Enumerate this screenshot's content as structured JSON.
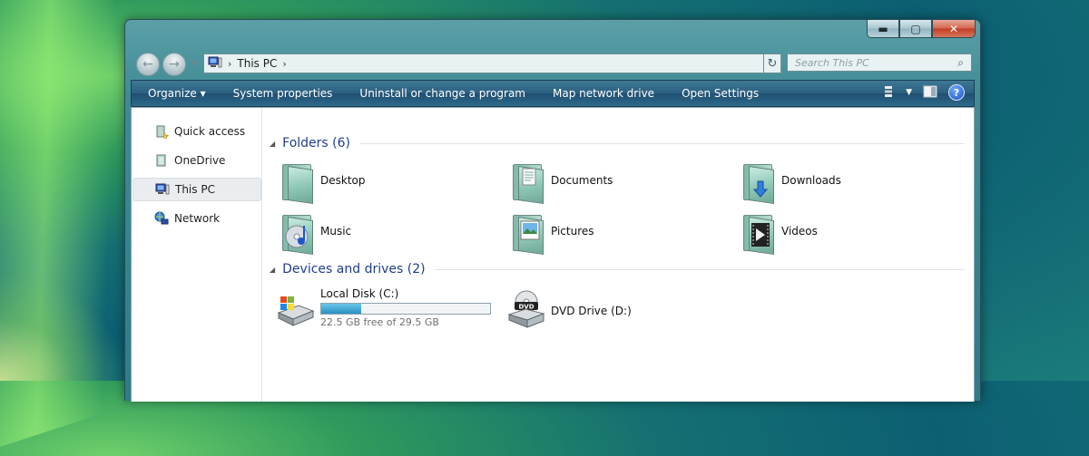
{
  "window": {
    "caption_buttons": {
      "minimize": "▬",
      "maximize": "▢",
      "close": "✕"
    }
  },
  "address_bar": {
    "separator": "›",
    "crumb": "This PC",
    "trailing_separator": "›",
    "dropdown": "⌄",
    "refresh": "↻"
  },
  "search": {
    "placeholder": "Search This PC",
    "icon": "search-icon"
  },
  "toolbar": {
    "organize": "Organize ▾",
    "items": [
      "System properties",
      "Uninstall or change a program",
      "Map network drive",
      "Open Settings"
    ]
  },
  "sidebar": {
    "items": [
      {
        "label": "Quick access",
        "icon": "quick-access-icon"
      },
      {
        "label": "OneDrive",
        "icon": "onedrive-icon"
      },
      {
        "label": "This PC",
        "icon": "this-pc-icon",
        "selected": true
      },
      {
        "label": "Network",
        "icon": "network-icon"
      }
    ]
  },
  "groups": {
    "folders": {
      "title": "Folders (6)",
      "items": [
        "Desktop",
        "Documents",
        "Downloads",
        "Music",
        "Pictures",
        "Videos"
      ]
    },
    "drives": {
      "title": "Devices and drives (2)",
      "local_disk": {
        "name": "Local Disk (C:)",
        "free_text": "22.5 GB free of 29.5 GB",
        "used_fraction": 0.237
      },
      "dvd": {
        "name": "DVD Drive (D:)",
        "disc_label": "DVD"
      }
    }
  },
  "colors": {
    "accent": "#1e3e8c",
    "toolbar": "#2b5f80",
    "drive_fill": "#2a8fc2"
  }
}
